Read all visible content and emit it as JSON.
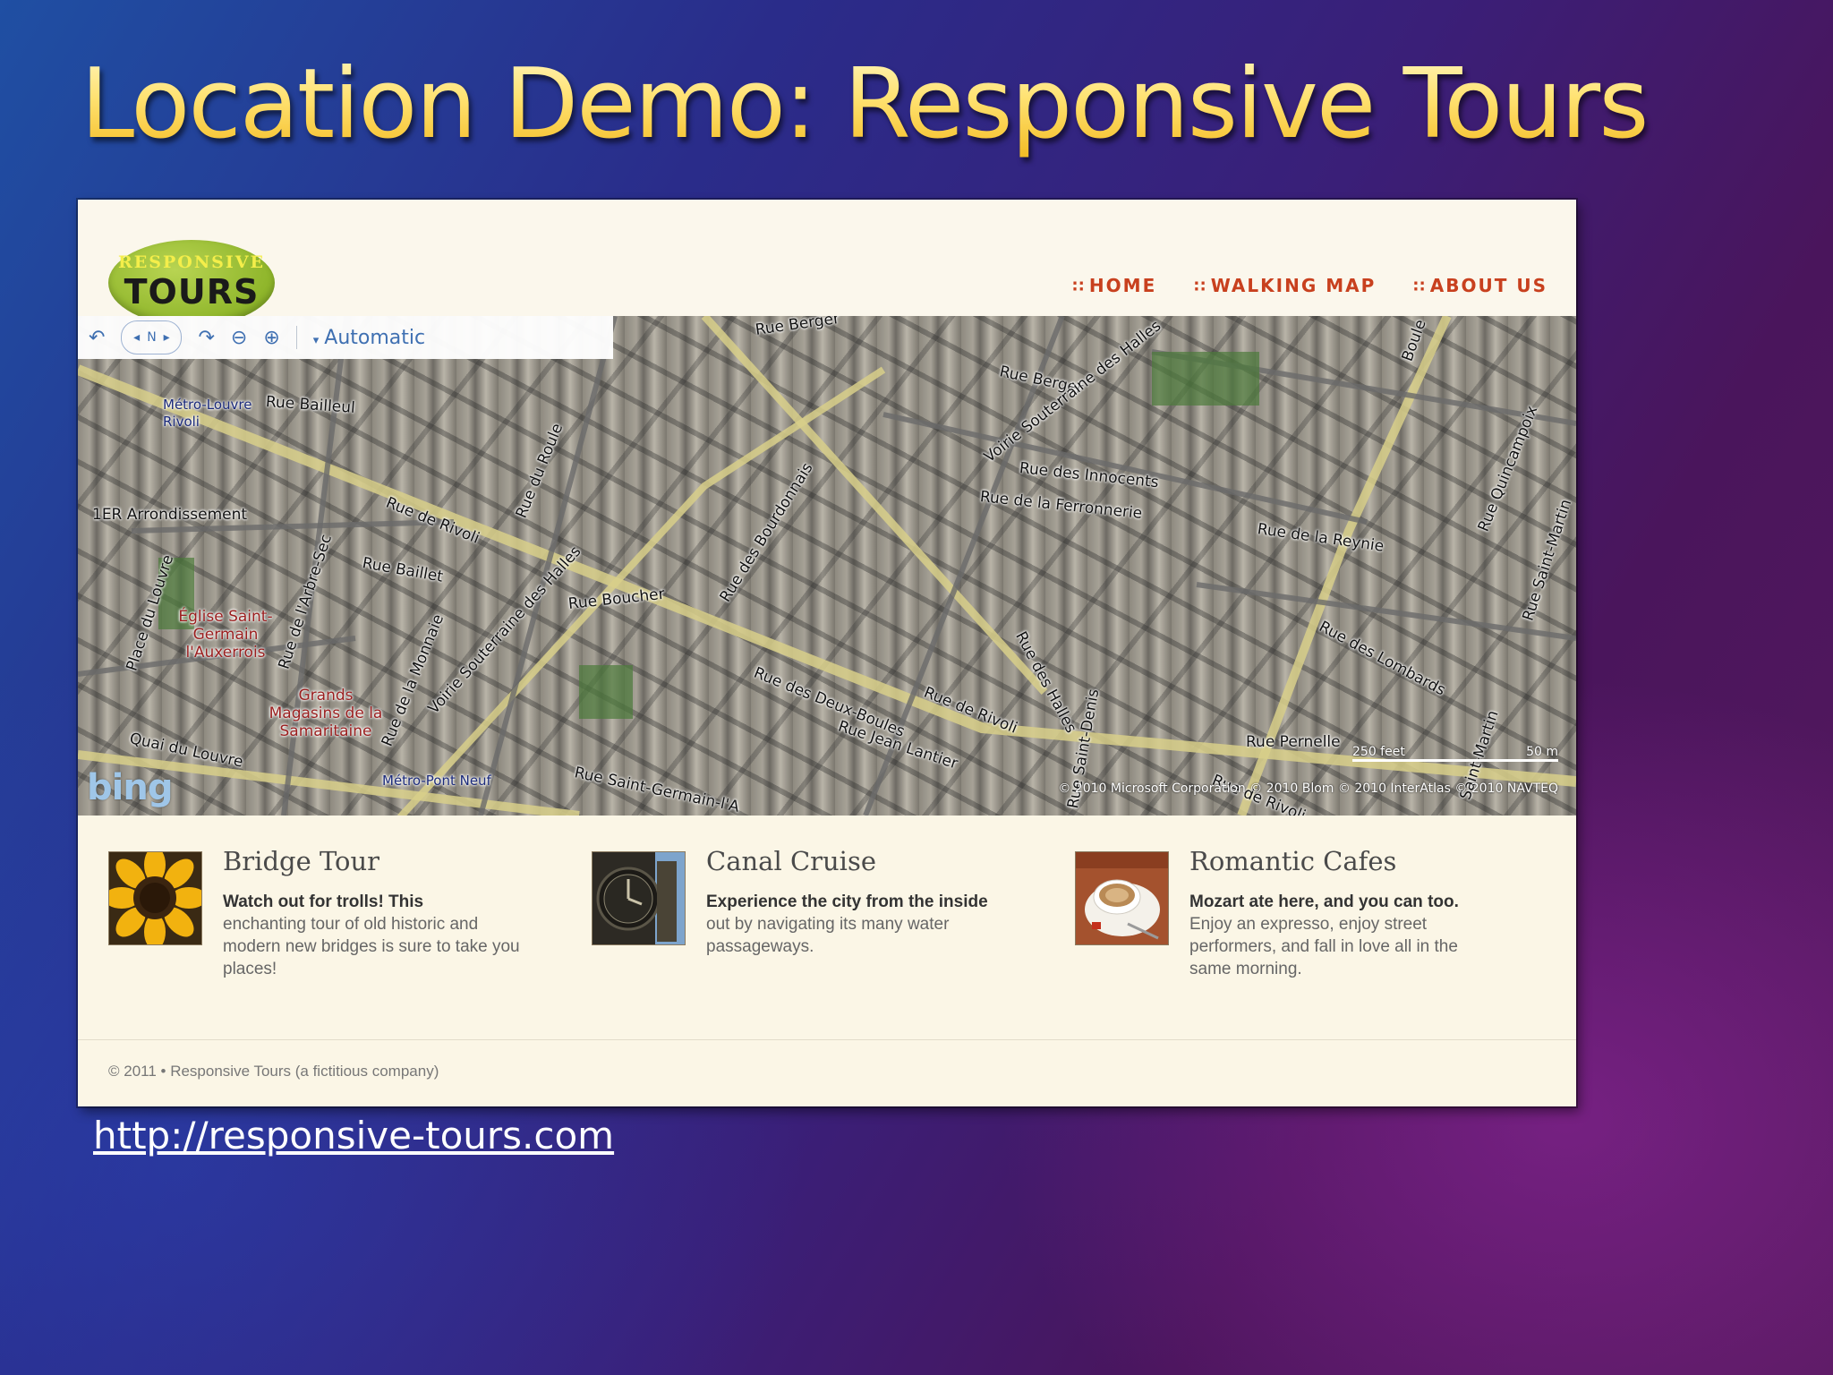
{
  "slide": {
    "title": "Location Demo: Responsive Tours",
    "link": "http://responsive-tours.com"
  },
  "site": {
    "logo_top": "RESPONSIVE",
    "logo_bottom": "TOURS",
    "nav": [
      {
        "label": "HOME"
      },
      {
        "label": "WALKING MAP"
      },
      {
        "label": "ABOUT US"
      }
    ],
    "footer": "© 2011 • Responsive Tours (a fictitious company)"
  },
  "map": {
    "mode_label": "Automatic",
    "compass_label": "N",
    "brand": "bing",
    "copyright": "© 2010 Microsoft Corporation © 2010 Blom © 2010 InterAtlas © 2010 NAVTEQ",
    "scale_feet": "250 feet",
    "scale_m": "50 m",
    "labels": {
      "rue_berger_top": "Rue Berger",
      "rue_berger": "Rue Berger",
      "metro_louvre": "Métro-Louvre Rivoli",
      "rue_bailleul": "Rue Bailleul",
      "voirie_halles_1": "Voirie Souterraine des Halles",
      "rue_innocents": "Rue des Innocents",
      "rue_ferronnerie": "Rue de la Ferronnerie",
      "rue_quincampoix": "Rue Quincampoix",
      "arrondissement": "1ER Arrondissement",
      "rue_rivoli_1": "Rue de Rivoli",
      "rue_roule": "Rue du Roule",
      "rue_reynie": "Rue de la Reynie",
      "rue_bourdonnais": "Rue des Bourdonnais",
      "rue_baillet": "Rue Baillet",
      "place_louvre": "Place du Louvre",
      "rue_arbre_sec": "Rue de l'Arbre-Sec",
      "eglise": "Église Saint-Germain l'Auxerrois",
      "rue_boucher": "Rue Boucher",
      "voirie_halles_2": "Voirie Souterraine des Halles",
      "rue_saint_martin": "Rue Saint-Martin",
      "rue_monnaie": "Rue de la Monnaie",
      "grands_magasins": "Grands Magasins de la Samaritaine",
      "rue_deux_boules": "Rue des Deux-Boules",
      "rue_rivoli_2": "Rue de Rivoli",
      "rue_halles": "Rue des Halles",
      "rue_lombards": "Rue des Lombards",
      "quai_louvre": "Quai du Louvre",
      "rue_jean_lantier": "Rue Jean Lantier",
      "rue_pernelle": "Rue Pernelle",
      "metro_pont_neuf": "Métro-Pont Neuf",
      "rue_saint_germain": "Rue Saint-Germain-l'A",
      "rue_saint_denis": "Rue Saint-Denis",
      "rue_rivoli_3": "Rue de Rivoli",
      "rue_boule": "Boule",
      "rue_saint_martin2": "Saint-Martin"
    }
  },
  "tours": [
    {
      "title": "Bridge Tour",
      "lead": "Watch out for trolls! This",
      "body": "enchanting tour of old historic and modern new bridges is sure to take you places!",
      "image": "sunflower"
    },
    {
      "title": "Canal Cruise",
      "lead": "Experience the city from the inside",
      "body": "out by navigating its many water passageways.",
      "image": "clock"
    },
    {
      "title": "Romantic Cafes",
      "lead": "Mozart ate here, and you can too.",
      "body": "Enjoy an expresso, enjoy street performers, and fall in love all in the same morning.",
      "image": "coffee-cup"
    }
  ]
}
